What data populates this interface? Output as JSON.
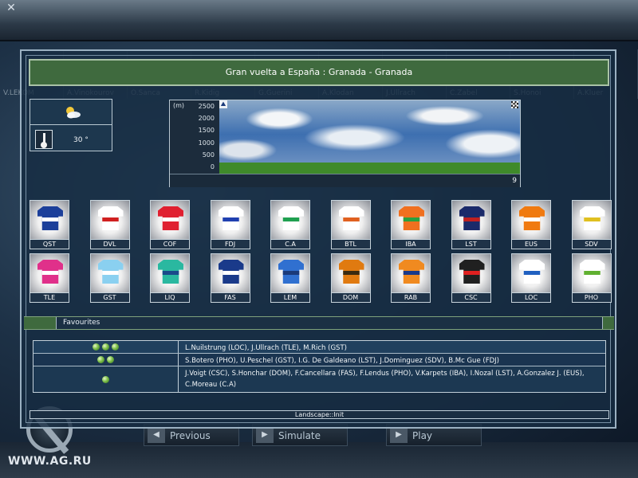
{
  "window": {
    "close_glyph": "✕"
  },
  "background": {
    "riders": [
      "V.LEKOM",
      "A.Vinokourov",
      "O.Sanca",
      "R.Kidig",
      "G.Guerini",
      "A.Klodan",
      "J.Ullrach",
      "C.Zabel",
      "S.Honoi",
      "A.Kluer"
    ],
    "watermark": "WWW.AG.RU"
  },
  "stage": {
    "title": "Gran vuelta a España : Granada - Granada"
  },
  "weather": {
    "icon": "partly-cloudy-icon",
    "temperature": "30 °"
  },
  "profile": {
    "unit": "(m)",
    "ticks": [
      "2500",
      "2000",
      "1500",
      "1000",
      "500",
      "0"
    ],
    "distance": "9"
  },
  "teams": [
    {
      "code": "QST",
      "colors": [
        "#1c3f9a",
        "#ffffff"
      ]
    },
    {
      "code": "DVL",
      "colors": [
        "#ffffff",
        "#d02020"
      ]
    },
    {
      "code": "COF",
      "colors": [
        "#e02030",
        "#ffffff"
      ]
    },
    {
      "code": "FDJ",
      "colors": [
        "#ffffff",
        "#2040b0"
      ]
    },
    {
      "code": "C.A",
      "colors": [
        "#ffffff",
        "#20a050"
      ]
    },
    {
      "code": "BTL",
      "colors": [
        "#ffffff",
        "#e06020"
      ]
    },
    {
      "code": "IBA",
      "colors": [
        "#f07020",
        "#2aa040"
      ]
    },
    {
      "code": "LST",
      "colors": [
        "#1a2a6a",
        "#c02020"
      ]
    },
    {
      "code": "EUS",
      "colors": [
        "#f07a10",
        "#ffffff"
      ]
    },
    {
      "code": "SDV",
      "colors": [
        "#ffffff",
        "#e0c020"
      ]
    },
    {
      "code": "TLE",
      "colors": [
        "#e0308a",
        "#ffffff"
      ]
    },
    {
      "code": "GST",
      "colors": [
        "#8ad0f0",
        "#ffffff"
      ]
    },
    {
      "code": "LIQ",
      "colors": [
        "#2ab8a0",
        "#1a4a8a"
      ]
    },
    {
      "code": "FAS",
      "colors": [
        "#1a3a8a",
        "#ffffff"
      ]
    },
    {
      "code": "LEM",
      "colors": [
        "#3070d0",
        "#1a3a7a"
      ]
    },
    {
      "code": "DOM",
      "colors": [
        "#e07a10",
        "#3a2a10"
      ]
    },
    {
      "code": "RAB",
      "colors": [
        "#f08a20",
        "#1a3a8a"
      ]
    },
    {
      "code": "CSC",
      "colors": [
        "#202020",
        "#e02020"
      ]
    },
    {
      "code": "LOC",
      "colors": [
        "#ffffff",
        "#2060c0"
      ]
    },
    {
      "code": "PHO",
      "colors": [
        "#ffffff",
        "#60b030"
      ]
    }
  ],
  "favourites": {
    "label": "Favourites",
    "rows": [
      {
        "stars": 3,
        "names": "L.Nuilstrung (LOC), J.Ullrach (TLE), M.Rich (GST)"
      },
      {
        "stars": 2,
        "names": "S.Botero (PHO), U.Peschel (GST), I.G. De Galdeano (LST), J.Dominguez (SDV), B.Mc Gue (FDJ)"
      },
      {
        "stars": 1,
        "names": "J.Voigt (CSC), S.Honchar (DOM), F.Cancellara (FAS), F.Lendus (PHO), V.Karpets (IBA), I.Nozal (LST), A.Gonzalez J. (EUS), C.Moreau (C.A)"
      }
    ]
  },
  "status": "Landscape::Init",
  "nav": {
    "previous": "Previous",
    "simulate": "Simulate",
    "play": "Play"
  }
}
